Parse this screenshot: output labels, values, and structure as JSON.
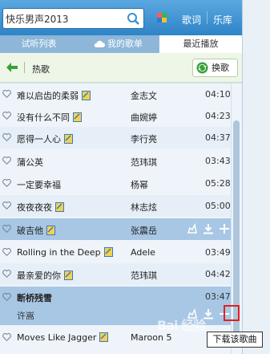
{
  "search": {
    "value": "快乐男声2013"
  },
  "top_links": {
    "lyrics": "歌词",
    "library": "乐库"
  },
  "tabs": [
    {
      "label": "试听列表"
    },
    {
      "label": "我的歌单"
    },
    {
      "label": "最近播放"
    }
  ],
  "header": {
    "title": "热歌",
    "swap_label": "换歌"
  },
  "songs": [
    {
      "title": "难以启齿的柔弱",
      "artist": "金志文",
      "duration": "04:10",
      "hq": true
    },
    {
      "title": "没有什么不同",
      "artist": "曲婉婷",
      "duration": "04:23",
      "hq": true
    },
    {
      "title": "愿得一人心",
      "artist": "李行亮",
      "duration": "04:37",
      "hq": true
    },
    {
      "title": "蒲公英",
      "artist": "范玮琪",
      "duration": "03:43",
      "hq": false
    },
    {
      "title": "一定要幸福",
      "artist": "杨幂",
      "duration": "05:28",
      "hq": false
    },
    {
      "title": "夜夜夜夜",
      "artist": "林志炫",
      "duration": "05:00",
      "hq": true
    },
    {
      "title": "破吉他",
      "artist": "张震岳",
      "duration": "",
      "hq": true
    },
    {
      "title": "Rolling in the Deep",
      "artist": "Adele",
      "duration": "03:49",
      "hq": true
    },
    {
      "title": "最亲爱的你",
      "artist": "范玮琪",
      "duration": "04:42",
      "hq": true
    },
    {
      "title": "断桥残雪",
      "artist": "许嵩",
      "duration": "03:47",
      "hq": false
    },
    {
      "title": "Moves Like Jagger",
      "artist": "Maroon 5",
      "duration": "",
      "hq": true
    }
  ],
  "tooltip": "下载该歌曲",
  "watermark": "Bai 经验",
  "colors": {
    "topbar": "#3a90d0",
    "row_highlight": "#a8c7e4",
    "accent_green": "#3aa13a",
    "highlight_box": "#e02020"
  }
}
